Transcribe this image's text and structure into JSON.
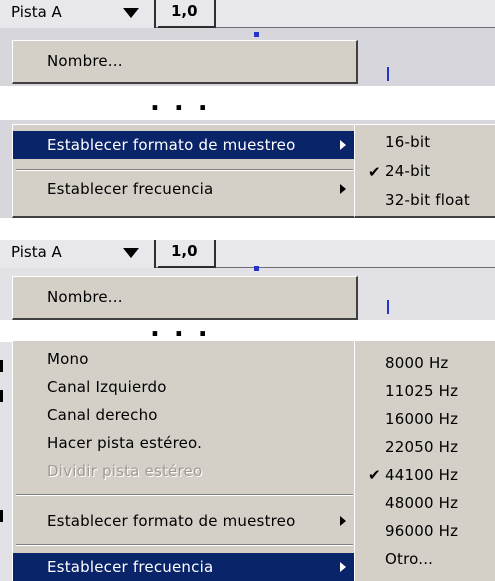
{
  "colors": {
    "menu_face": "#d4d0c8",
    "highlight": "#0a246a",
    "highlight_text": "#ffffff",
    "disabled_text": "#a09c94",
    "waveform_marker": "#2435c8"
  },
  "top_panel": {
    "track_name": "Pista A",
    "dropdown_icon": "triangle-down-icon",
    "track_value": "1,0",
    "menu_items": {
      "name": "Nombre...",
      "set_format": "Establecer formato de muestreo",
      "set_rate": "Establecer frecuencia"
    },
    "ellipsis": "...",
    "format_submenu": {
      "items": [
        "16-bit",
        "24-bit",
        "32-bit float"
      ],
      "checked": "24-bit"
    }
  },
  "bottom_panel": {
    "track_name": "Pista A",
    "dropdown_icon": "triangle-down-icon",
    "track_value": "1,0",
    "menu_items": {
      "name": "Nombre...",
      "mono": "Mono",
      "left": "Canal Izquierdo",
      "right": "Canal derecho",
      "make_stereo": "Hacer pista estéreo.",
      "split_stereo": "Dividir pista estéreo",
      "set_format": "Establecer formato de muestreo",
      "set_rate": "Establecer frecuencia"
    },
    "ellipsis": "...",
    "rate_submenu": {
      "items": [
        "8000 Hz",
        "11025 Hz",
        "16000 Hz",
        "22050 Hz",
        "44100 Hz",
        "48000 Hz",
        "96000 Hz",
        "Otro..."
      ],
      "checked": "44100 Hz"
    }
  },
  "icons": {
    "check": "✔",
    "submenu_arrow": "submenu-arrow-icon"
  }
}
